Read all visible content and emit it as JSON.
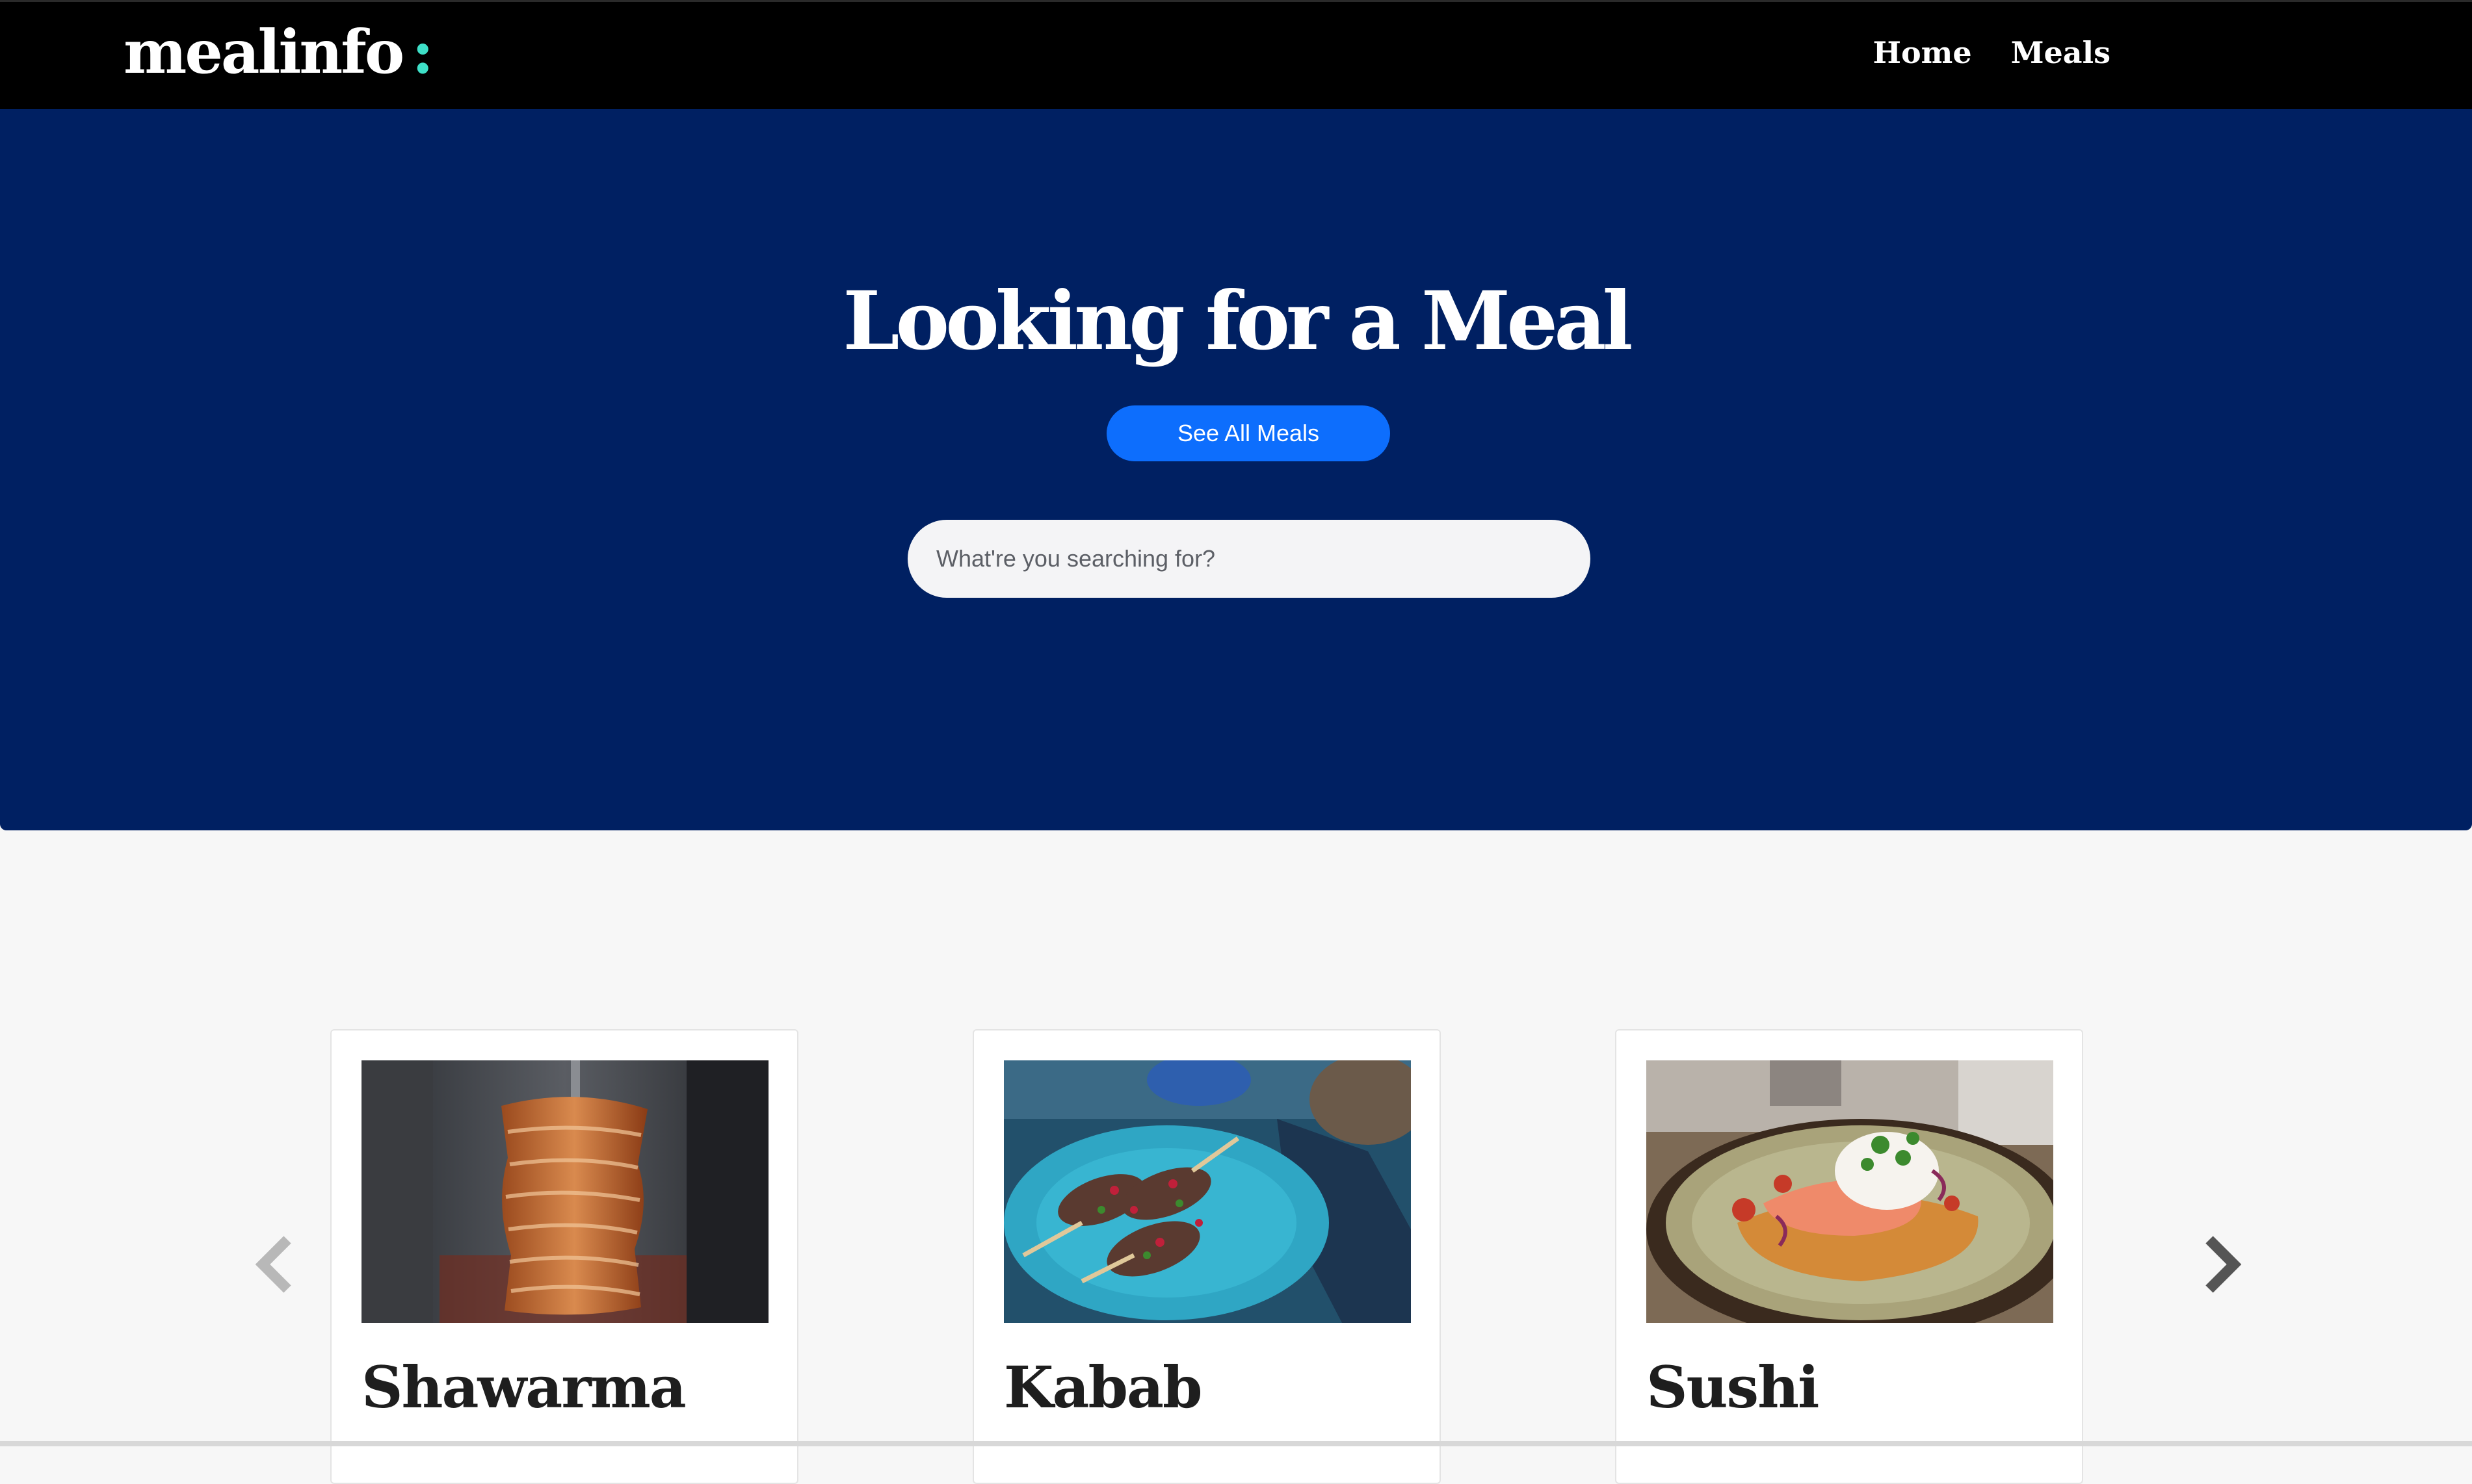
{
  "navbar": {
    "brand": "mealinfo",
    "brand_suffix": ":",
    "links": [
      {
        "label": "Home"
      },
      {
        "label": "Meals"
      }
    ]
  },
  "hero": {
    "title": "Looking for a Meal",
    "cta_label": "See All Meals",
    "search_placeholder": "What're you searching for?",
    "search_value": ""
  },
  "carousel": {
    "prev_icon": "chevron-left-icon",
    "next_icon": "chevron-right-icon",
    "cards": [
      {
        "title": "Shawarma",
        "image": "shawarma-photo"
      },
      {
        "title": "Kabab",
        "image": "kabab-photo"
      },
      {
        "title": "Sushi",
        "image": "sushi-photo"
      }
    ]
  },
  "colors": {
    "navbar_bg": "#000000",
    "hero_bg": "#002062",
    "accent": "#3ee0c8",
    "button": "#0d6efd",
    "page_bg": "#f7f7f7"
  }
}
